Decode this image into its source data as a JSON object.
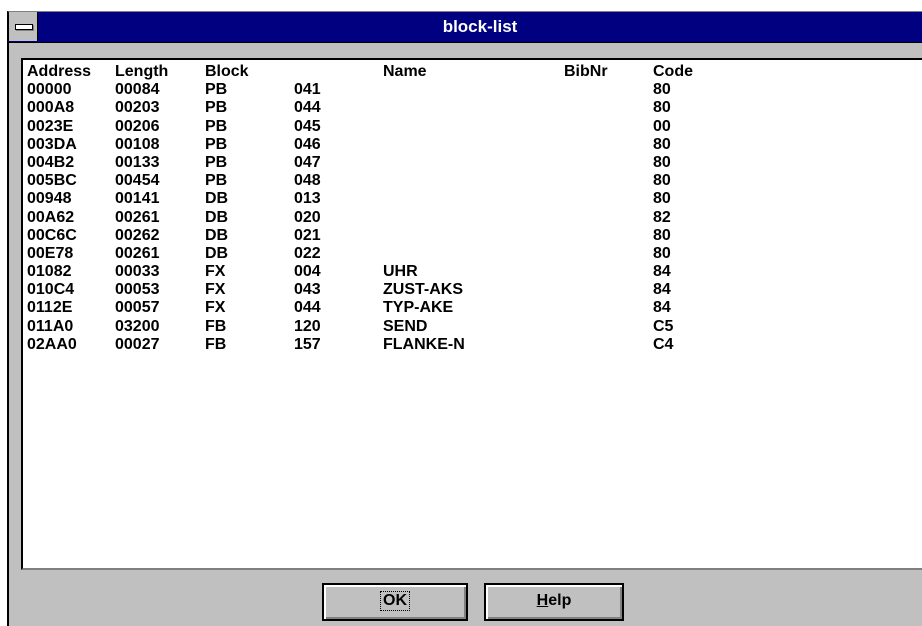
{
  "window": {
    "title": "block-list"
  },
  "list": {
    "headers": {
      "address": "Address",
      "length": "Length",
      "block": "Block",
      "number": "",
      "name": "Name",
      "bibnr": "BibNr",
      "code": "Code"
    },
    "rows": [
      {
        "address": "00000",
        "length": "00084",
        "block": "PB",
        "number": "041",
        "name": "",
        "bibnr": "",
        "code": "80"
      },
      {
        "address": "000A8",
        "length": "00203",
        "block": "PB",
        "number": "044",
        "name": "",
        "bibnr": "",
        "code": "80"
      },
      {
        "address": "0023E",
        "length": "00206",
        "block": "PB",
        "number": "045",
        "name": "",
        "bibnr": "",
        "code": "00"
      },
      {
        "address": "003DA",
        "length": "00108",
        "block": "PB",
        "number": "046",
        "name": "",
        "bibnr": "",
        "code": "80"
      },
      {
        "address": "004B2",
        "length": "00133",
        "block": "PB",
        "number": "047",
        "name": "",
        "bibnr": "",
        "code": "80"
      },
      {
        "address": "005BC",
        "length": "00454",
        "block": "PB",
        "number": "048",
        "name": "",
        "bibnr": "",
        "code": "80"
      },
      {
        "address": "00948",
        "length": "00141",
        "block": "DB",
        "number": "013",
        "name": "",
        "bibnr": "",
        "code": "80"
      },
      {
        "address": "00A62",
        "length": "00261",
        "block": "DB",
        "number": "020",
        "name": "",
        "bibnr": "",
        "code": "82"
      },
      {
        "address": "00C6C",
        "length": "00262",
        "block": "DB",
        "number": "021",
        "name": "",
        "bibnr": "",
        "code": "80"
      },
      {
        "address": "00E78",
        "length": "00261",
        "block": "DB",
        "number": "022",
        "name": "",
        "bibnr": "",
        "code": "80"
      },
      {
        "address": "01082",
        "length": "00033",
        "block": "FX",
        "number": "004",
        "name": "UHR",
        "bibnr": "",
        "code": "84"
      },
      {
        "address": "010C4",
        "length": "00053",
        "block": "FX",
        "number": "043",
        "name": "ZUST-AKS",
        "bibnr": "",
        "code": "84"
      },
      {
        "address": "0112E",
        "length": "00057",
        "block": "FX",
        "number": "044",
        "name": "TYP-AKE",
        "bibnr": "",
        "code": "84"
      },
      {
        "address": "011A0",
        "length": "03200",
        "block": "FB",
        "number": "120",
        "name": "SEND",
        "bibnr": "",
        "code": "C5"
      },
      {
        "address": "02AA0",
        "length": "00027",
        "block": "FB",
        "number": "157",
        "name": "FLANKE-N",
        "bibnr": "",
        "code": "C4"
      }
    ]
  },
  "buttons": {
    "ok_label": "OK",
    "help_mnemonic": "H",
    "help_rest": "elp"
  },
  "icons": {
    "system_menu": "system-menu-icon"
  },
  "colors": {
    "titlebar": "#000080",
    "dialog_bg": "#c0c0c0",
    "list_bg": "#ffffff"
  }
}
